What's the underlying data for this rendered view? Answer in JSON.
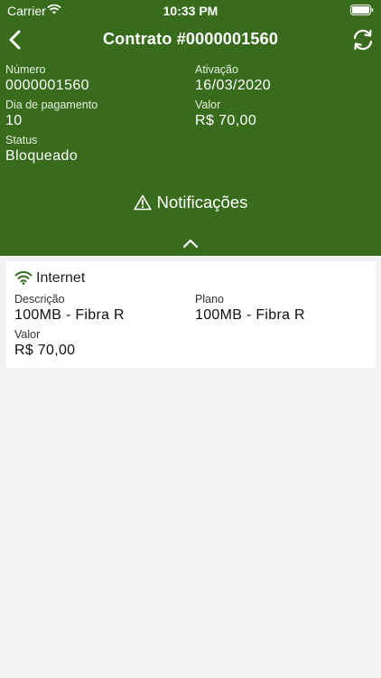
{
  "status_bar": {
    "carrier": "Carrier",
    "time": "10:33 PM"
  },
  "nav": {
    "title": "Contrato #0000001560"
  },
  "contract": {
    "numero_label": "Número",
    "numero_value": "0000001560",
    "ativacao_label": "Ativação",
    "ativacao_value": "16/03/2020",
    "dia_label": "Dia de pagamento",
    "dia_value": "10",
    "valor_label": "Valor",
    "valor_value": "R$ 70,00",
    "status_label": "Status",
    "status_value": "Bloqueado"
  },
  "notifications": {
    "label": "Notificações"
  },
  "service": {
    "title": "Internet",
    "descricao_label": "Descrição",
    "descricao_value": "100MB - Fibra R",
    "plano_label": "Plano",
    "plano_value": "100MB - Fibra R",
    "valor_label": "Valor",
    "valor_value": "R$ 70,00"
  },
  "colors": {
    "header_bg": "#386b1b",
    "wifi_icon": "#2e6b1a",
    "page_bg": "#f2f2f2"
  }
}
